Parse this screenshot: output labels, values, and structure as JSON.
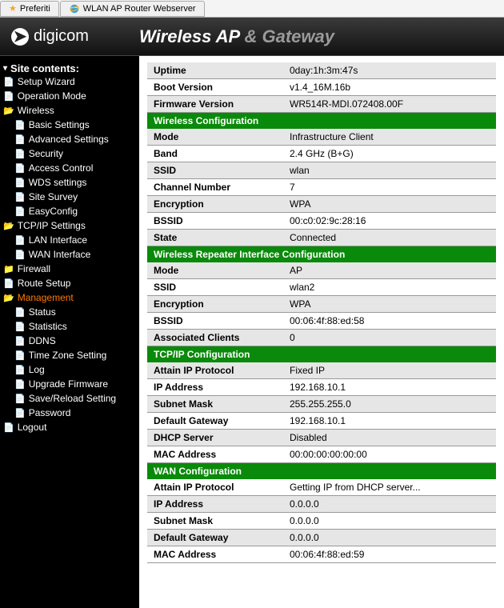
{
  "tabs": {
    "fav": "Preferiti",
    "page": "WLAN AP Router Webserver"
  },
  "brand": "digicom",
  "title_strong": "Wireless AP",
  "title_gray": "& Gateway",
  "siteContents": "Site contents:",
  "nav": {
    "setup": "Setup Wizard",
    "opmode": "Operation Mode",
    "wireless": "Wireless",
    "wireless_items": [
      "Basic Settings",
      "Advanced Settings",
      "Security",
      "Access Control",
      "WDS settings",
      "Site Survey",
      "EasyConfig"
    ],
    "tcpip": "TCP/IP Settings",
    "tcpip_items": [
      "LAN Interface",
      "WAN Interface"
    ],
    "firewall": "Firewall",
    "route": "Route Setup",
    "mgmt": "Management",
    "mgmt_items": [
      "Status",
      "Statistics",
      "DDNS",
      "Time Zone Setting",
      "Log",
      "Upgrade Firmware",
      "Save/Reload Setting",
      "Password"
    ],
    "logout": "Logout"
  },
  "sections": {
    "sys": [
      {
        "k": "Uptime",
        "v": "0day:1h:3m:47s"
      },
      {
        "k": "Boot Version",
        "v": "v1.4_16M.16b"
      },
      {
        "k": "Firmware Version",
        "v": "WR514R-MDI.072408.00F"
      }
    ],
    "wlan_h": "Wireless Configuration",
    "wlan": [
      {
        "k": "Mode",
        "v": "Infrastructure Client"
      },
      {
        "k": "Band",
        "v": "2.4 GHz (B+G)"
      },
      {
        "k": "SSID",
        "v": "wlan"
      },
      {
        "k": "Channel Number",
        "v": "7"
      },
      {
        "k": "Encryption",
        "v": "WPA"
      },
      {
        "k": "BSSID",
        "v": "00:c0:02:9c:28:16"
      },
      {
        "k": "State",
        "v": "Connected"
      }
    ],
    "rpt_h": "Wireless Repeater Interface Configuration",
    "rpt": [
      {
        "k": "Mode",
        "v": "AP"
      },
      {
        "k": "SSID",
        "v": "wlan2"
      },
      {
        "k": "Encryption",
        "v": "WPA"
      },
      {
        "k": "BSSID",
        "v": "00:06:4f:88:ed:58"
      },
      {
        "k": "Associated Clients",
        "v": "0"
      }
    ],
    "tcp_h": "TCP/IP Configuration",
    "tcp": [
      {
        "k": "Attain IP Protocol",
        "v": "Fixed IP"
      },
      {
        "k": "IP Address",
        "v": "192.168.10.1"
      },
      {
        "k": "Subnet Mask",
        "v": "255.255.255.0"
      },
      {
        "k": "Default Gateway",
        "v": "192.168.10.1"
      },
      {
        "k": "DHCP Server",
        "v": "Disabled"
      },
      {
        "k": "MAC Address",
        "v": "00:00:00:00:00:00"
      }
    ],
    "wan_h": "WAN Configuration",
    "wan": [
      {
        "k": "Attain IP Protocol",
        "v": "Getting IP from DHCP server..."
      },
      {
        "k": "IP Address",
        "v": "0.0.0.0"
      },
      {
        "k": "Subnet Mask",
        "v": "0.0.0.0"
      },
      {
        "k": "Default Gateway",
        "v": "0.0.0.0"
      },
      {
        "k": "MAC Address",
        "v": "00:06:4f:88:ed:59"
      }
    ]
  }
}
